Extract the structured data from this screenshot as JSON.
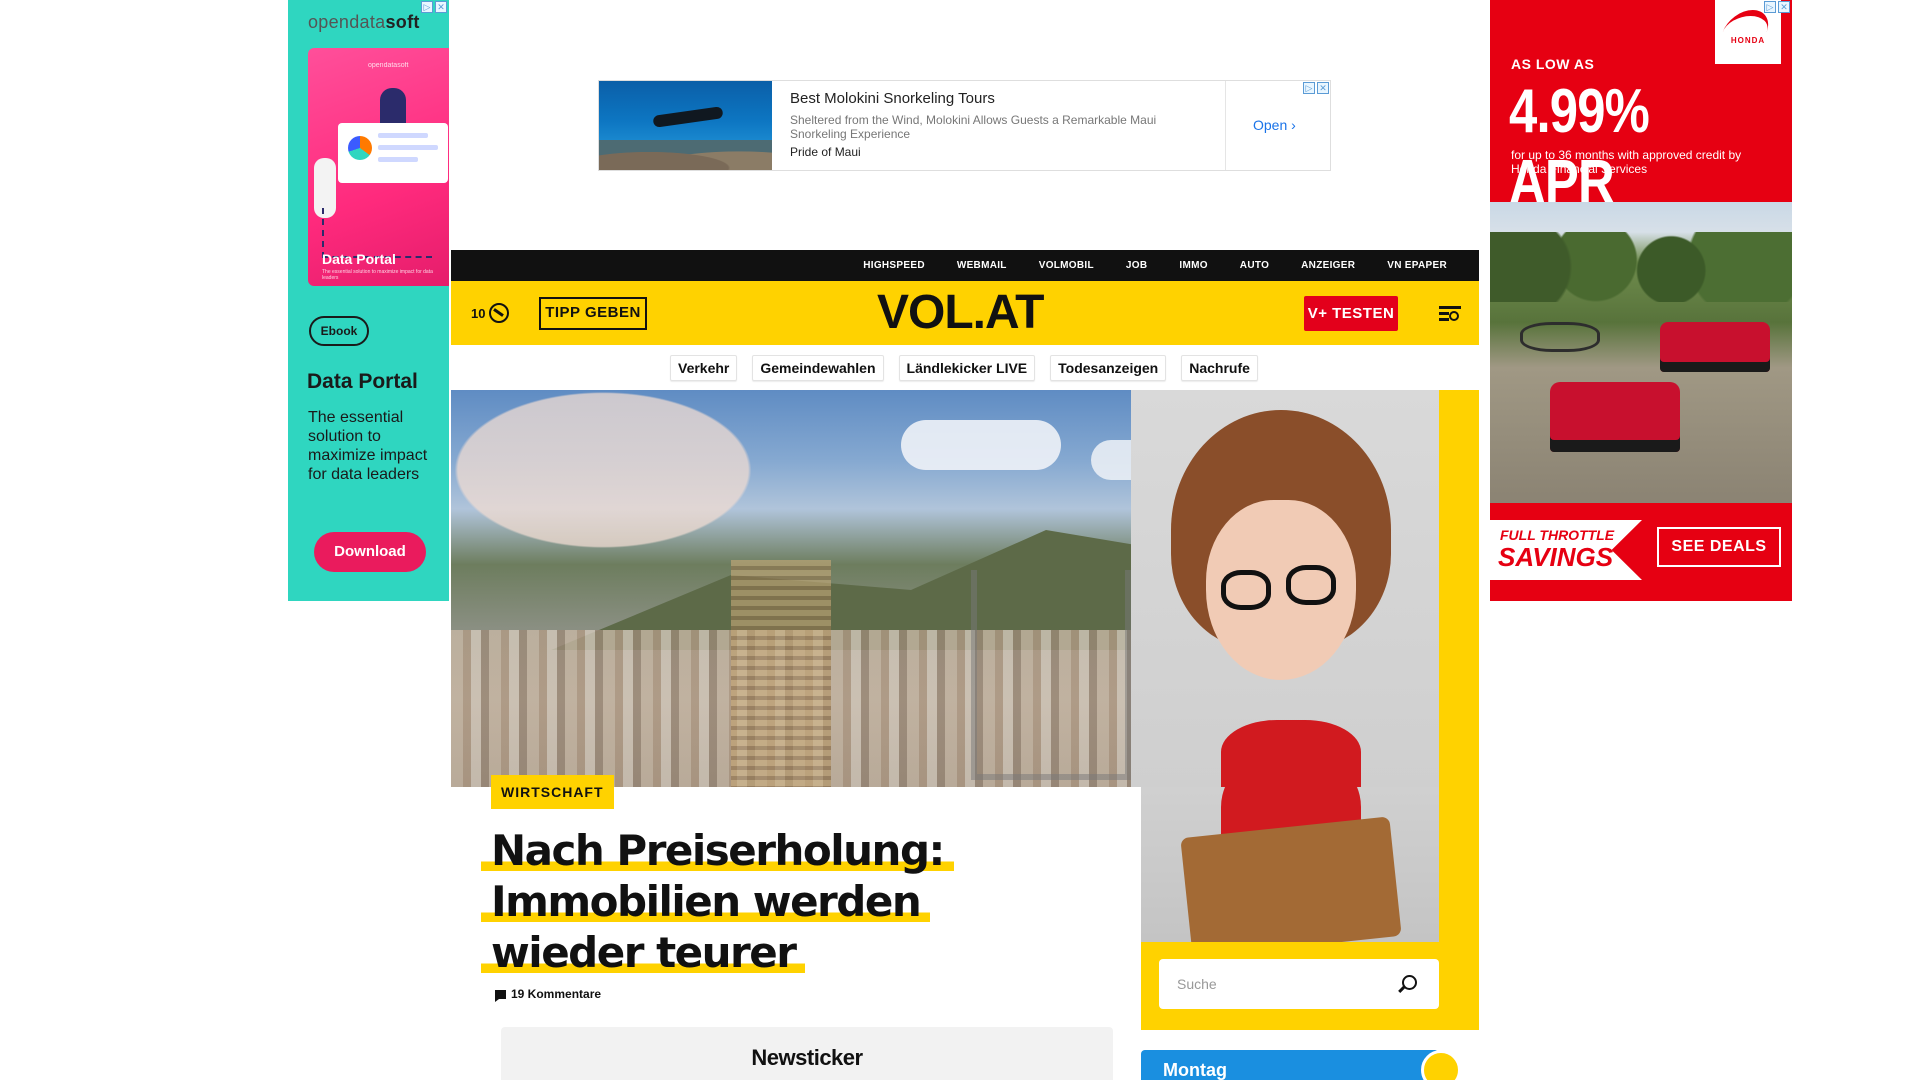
{
  "left_ad": {
    "brand_prefix": "opendata",
    "brand_suffix": "soft",
    "image_brand": "opendatasoft",
    "image_label": "Data Portal",
    "image_sub": "The essential solution to maximize impact for data leaders",
    "badge": "Ebook",
    "headline": "Data Portal",
    "body": "The essential solution to maximize impact for data leaders",
    "cta": "Download",
    "adchoice": "▷",
    "close": "✕"
  },
  "top_ad": {
    "title": "Best Molokini Snorkeling Tours",
    "description": "Sheltered from the Wind, Molokini Allows Guests a Remarkable Maui Snorkeling Experience",
    "advertiser": "Pride of Maui",
    "cta": "Open",
    "cta_chevron": "›",
    "adchoice": "▷",
    "close": "✕"
  },
  "right_ad": {
    "logo_text": "HONDA",
    "as_low_as": "AS LOW AS",
    "rate": "4.99% APR",
    "terms": "for up to 36 months with approved credit by Honda Financial Services",
    "savings_line1": "FULL THROTTLE",
    "savings_line2": "SAVINGS",
    "cta": "SEE DEALS",
    "adchoice": "▷",
    "close": "✕"
  },
  "top_nav": {
    "links": [
      "HIGHSPEED",
      "WEBMAIL",
      "VOLMOBIL",
      "JOB",
      "IMMO",
      "AUTO",
      "ANZEIGER",
      "VN EPAPER"
    ]
  },
  "header": {
    "counter": "10",
    "tip_button": "TIPP GEBEN",
    "logo": "VOL.AT",
    "subscribe_button": "V+ TESTEN"
  },
  "sub_nav": {
    "chips": [
      "Verkehr",
      "Gemeindewahlen",
      "Ländlekicker LIVE",
      "Todesanzeigen",
      "Nachrufe"
    ]
  },
  "article": {
    "category": "WIRTSCHAFT",
    "headline": "Nach Preiserholung: Immobilien werden wieder teurer",
    "comments": "19 Kommentare"
  },
  "newsticker": {
    "title": "Newsticker"
  },
  "search": {
    "placeholder": "Suche"
  },
  "weather": {
    "day": "Montag"
  },
  "colors": {
    "brand_yellow": "#ffd200",
    "brand_red": "#e3001b",
    "nav_black": "#111111",
    "ad_teal": "#2fd6c0",
    "ad_pink": "#ea1b5d",
    "honda_red": "#e60012",
    "weather_blue": "#1a8fe0"
  },
  "icons": {
    "counter": "clock-icon",
    "menu": "menu-search-icon",
    "search": "search-icon",
    "comments": "comment-icon",
    "open_chevron": "chevron-right-icon"
  }
}
